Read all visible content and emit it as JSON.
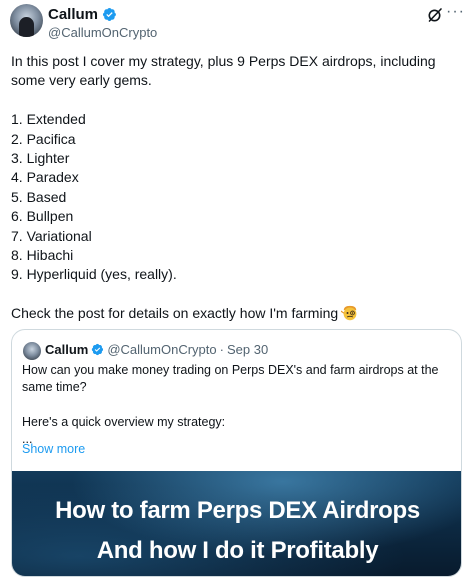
{
  "author": {
    "name": "Callum",
    "handle": "@CallumOnCrypto"
  },
  "post": {
    "intro": "In this post I cover my strategy, plus 9 Perps DEX airdrops, including some very early gems.",
    "list": [
      "1. Extended",
      "2. Pacifica",
      "3. Lighter",
      "4. Paradex",
      "5. Based",
      "6. Bullpen",
      "7. Variational",
      "8. Hibachi",
      "9. Hyperliquid (yes, really)."
    ],
    "outro": "Check the post for details on exactly how I'm farming"
  },
  "quote": {
    "name": "Callum",
    "handle": "@CallumOnCrypto",
    "separator": "·",
    "date": "Sep 30",
    "line1": "How can you make money trading on Perps DEX's and farm airdrops at the same time?",
    "line2": "Here's a quick overview my strategy:",
    "line3": "...",
    "show_more": "Show more",
    "image_line1": "How to farm Perps DEX Airdrops",
    "image_line2": "And how I do it Profitably"
  },
  "icons": {
    "verified": "verified-badge-icon",
    "grok": "grok-icon",
    "more": "more-icon",
    "emoji": "face-with-monocle-emoji"
  },
  "colors": {
    "verified": "#1d9bf0",
    "link": "#1d9bf0",
    "secondary_text": "#536471",
    "border": "#cfd9de"
  }
}
